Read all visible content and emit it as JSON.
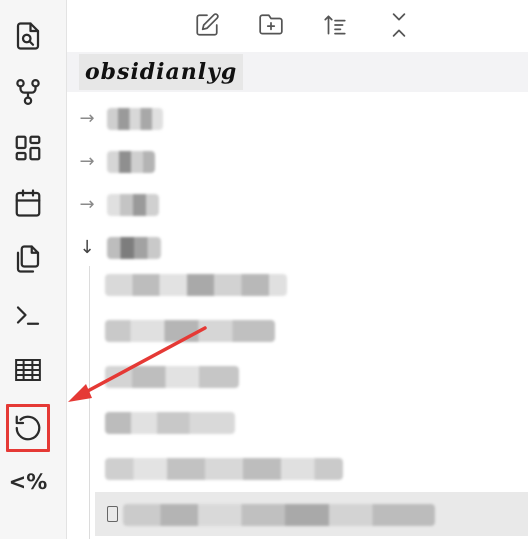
{
  "ribbon": {
    "items": [
      {
        "name": "search-file-icon"
      },
      {
        "name": "graph-view-icon"
      },
      {
        "name": "canvas-icon"
      },
      {
        "name": "daily-note-calendar-icon"
      },
      {
        "name": "copy-files-icon"
      },
      {
        "name": "command-palette-icon"
      },
      {
        "name": "table-icon"
      },
      {
        "name": "history-restore-icon"
      },
      {
        "name": "template-code-icon",
        "label": "<%"
      }
    ]
  },
  "nav": {
    "buttons": [
      "new-note-icon",
      "new-folder-icon",
      "sort-icon",
      "collapse-all-icon"
    ]
  },
  "vault": {
    "name": "obsidianlyg"
  },
  "annotation": {
    "color": "#e53935"
  }
}
